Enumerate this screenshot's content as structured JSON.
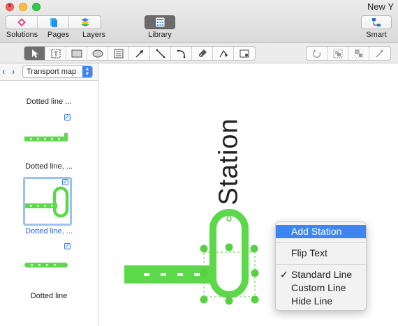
{
  "window": {
    "title": "New Y"
  },
  "toolbar": {
    "solutions_label": "Solutions",
    "pages_label": "Pages",
    "layers_label": "Layers",
    "library_label": "Library",
    "smart_label": "Smart"
  },
  "tools": [
    "selection-tool",
    "text-tool",
    "rectangle-tool",
    "oval-tool",
    "table-tool",
    "arrow-line-tool",
    "line-tool",
    "curve-tool",
    "pen-tool",
    "bezier-tool",
    "image-tool",
    "rotate-tool",
    "group-tool",
    "ungroup-tool",
    "connect-tool"
  ],
  "sidebar": {
    "stencil_selected": "Transport map",
    "items": [
      {
        "label": "Dotted line ...",
        "selected": false
      },
      {
        "label": "Dotted line, ...",
        "selected": false
      },
      {
        "label": "Dotted line, ...",
        "selected": true
      },
      {
        "label": "Dotted line",
        "selected": false
      }
    ]
  },
  "canvas": {
    "station_text": "Station"
  },
  "context_menu": {
    "items": [
      {
        "label": "Add Station",
        "highlighted": true,
        "checked": false
      },
      {
        "label": "Flip Text",
        "highlighted": false,
        "checked": false
      },
      {
        "label": "Standard Line",
        "highlighted": false,
        "checked": true
      },
      {
        "label": "Custom Line",
        "highlighted": false,
        "checked": false
      },
      {
        "label": "Hide Line",
        "highlighted": false,
        "checked": false
      }
    ],
    "check_mark": "✓"
  },
  "colors": {
    "line_green": "#5cd84a",
    "selection_blue": "#3d86f2",
    "handle_green": "#57d040"
  }
}
